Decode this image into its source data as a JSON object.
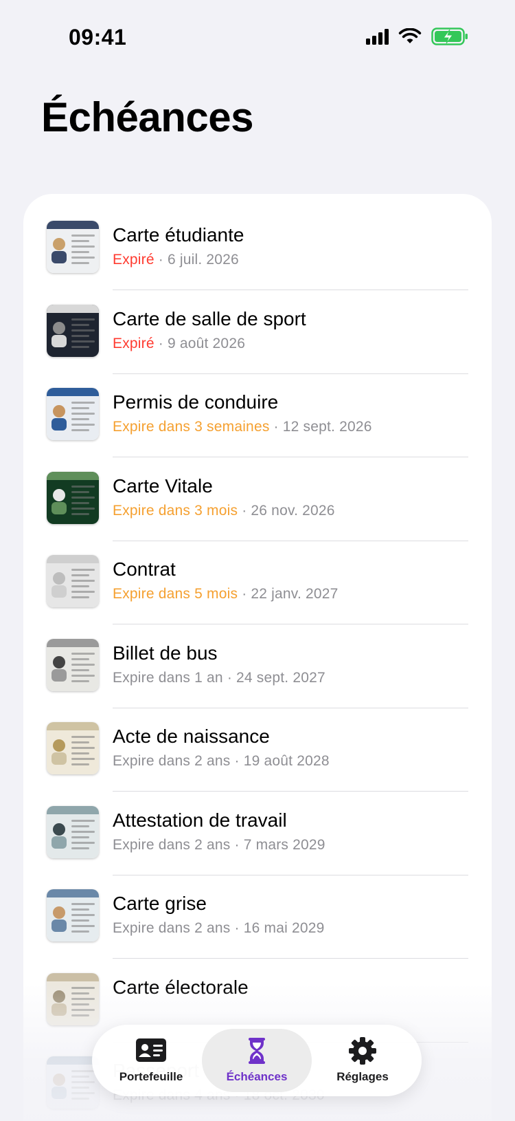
{
  "status_bar": {
    "time": "09:41",
    "icons": [
      "cellular-signal-icon",
      "wifi-icon",
      "battery-charging-icon"
    ],
    "battery_color": "#34c759"
  },
  "page": {
    "title": "Échéances"
  },
  "colors": {
    "expired": "#ff3b30",
    "warning": "#f5a030",
    "secondary": "#8e8e93",
    "accent": "#6f32c9"
  },
  "documents": [
    {
      "title": "Carte étudiante",
      "status": "Expiré",
      "status_level": "expired",
      "date": "6 juil. 2026"
    },
    {
      "title": "Carte de salle de sport",
      "status": "Expiré",
      "status_level": "expired",
      "date": "9 août 2026"
    },
    {
      "title": "Permis de conduire",
      "status": "Expire dans 3 semaines",
      "status_level": "warning",
      "date": "12 sept. 2026"
    },
    {
      "title": "Carte Vitale",
      "status": "Expire dans 3 mois",
      "status_level": "warning",
      "date": "26 nov. 2026"
    },
    {
      "title": "Contrat",
      "status": "Expire dans 5 mois",
      "status_level": "warning",
      "date": "22 janv. 2027"
    },
    {
      "title": "Billet de bus",
      "status": "Expire dans 1 an",
      "status_level": "normal",
      "date": "24 sept. 2027"
    },
    {
      "title": "Acte de naissance",
      "status": "Expire dans 2 ans",
      "status_level": "normal",
      "date": "19 août 2028"
    },
    {
      "title": "Attestation de travail",
      "status": "Expire dans 2 ans",
      "status_level": "normal",
      "date": "7 mars 2029"
    },
    {
      "title": "Carte grise",
      "status": "Expire dans 2 ans",
      "status_level": "normal",
      "date": "16 mai 2029"
    },
    {
      "title": "Carte électorale",
      "status": "",
      "status_level": "normal",
      "date": ""
    },
    {
      "title": "Passeport",
      "status": "Expire dans 4 ans",
      "status_level": "normal",
      "date": "18 oct. 2030"
    }
  ],
  "separator": "·",
  "tabbar": {
    "tabs": [
      {
        "label": "Portefeuille",
        "icon": "id-card-icon",
        "active": false
      },
      {
        "label": "Échéances",
        "icon": "hourglass-icon",
        "active": true
      },
      {
        "label": "Réglages",
        "icon": "gear-icon",
        "active": false
      }
    ]
  }
}
